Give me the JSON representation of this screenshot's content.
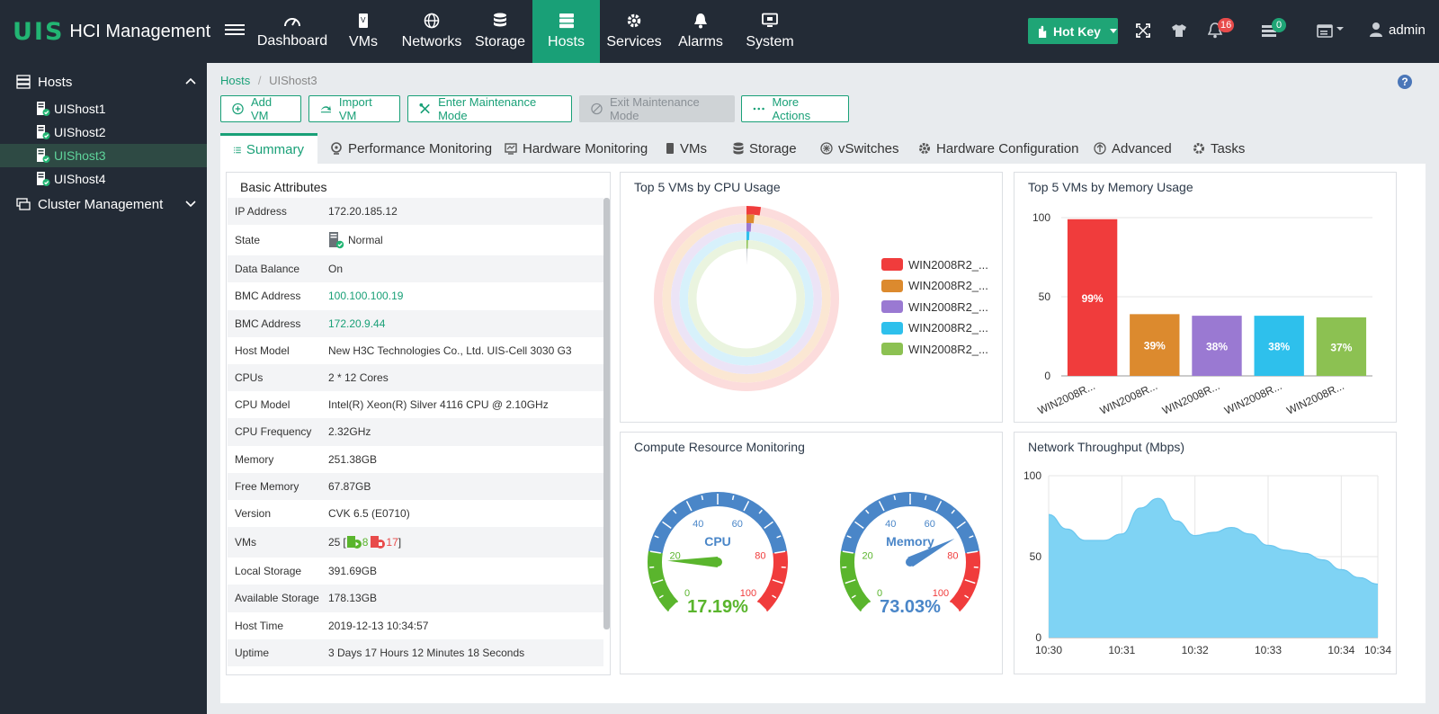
{
  "app": {
    "logo_mark": "UIS",
    "logo_text": "HCI Management"
  },
  "nav": [
    {
      "label": "Dashboard",
      "icon": "dashboard-icon"
    },
    {
      "label": "VMs",
      "icon": "vm-icon"
    },
    {
      "label": "Networks",
      "icon": "globe-icon"
    },
    {
      "label": "Storage",
      "icon": "database-icon"
    },
    {
      "label": "Hosts",
      "icon": "server-icon",
      "active": true
    },
    {
      "label": "Services",
      "icon": "gear-icon"
    },
    {
      "label": "Alarms",
      "icon": "bell-icon"
    },
    {
      "label": "System",
      "icon": "monitor-icon"
    }
  ],
  "topright": {
    "hotkey": "Hot Key",
    "alarm_count": "16",
    "task_count": "0",
    "user": "admin"
  },
  "sidebar": {
    "hosts_header": "Hosts",
    "hosts": [
      "UIShost1",
      "UIShost2",
      "UIShost3",
      "UIShost4"
    ],
    "active_host": "UIShost3",
    "cluster_header": "Cluster Management"
  },
  "breadcrumb": {
    "root": "Hosts",
    "sep": "/",
    "current": "UIShost3"
  },
  "actions": {
    "add_vm": "Add VM",
    "import_vm": "Import VM",
    "enter_maint": "Enter Maintenance Mode",
    "exit_maint": "Exit Maintenance Mode",
    "more": "More Actions"
  },
  "tabs": [
    "Summary",
    "Performance Monitoring",
    "Hardware Monitoring",
    "VMs",
    "Storage",
    "vSwitches",
    "Hardware Configuration",
    "Advanced",
    "Tasks"
  ],
  "basic": {
    "title": "Basic Attributes",
    "rows": [
      {
        "k": "IP Address",
        "v": "172.20.185.12"
      },
      {
        "k": "State",
        "v": "Normal"
      },
      {
        "k": "Data Balance",
        "v": "On"
      },
      {
        "k": "BMC Address",
        "v": "100.100.100.19"
      },
      {
        "k": "BMC Address",
        "v": "172.20.9.44"
      },
      {
        "k": "Host Model",
        "v": "New H3C Technologies Co., Ltd. UIS-Cell 3030 G3"
      },
      {
        "k": "CPUs",
        "v": "2 * 12 Cores"
      },
      {
        "k": "CPU Model",
        "v": "Intel(R) Xeon(R) Silver 4116 CPU @ 2.10GHz"
      },
      {
        "k": "CPU Frequency",
        "v": "2.32GHz"
      },
      {
        "k": "Memory",
        "v": "251.38GB"
      },
      {
        "k": "Free Memory",
        "v": "67.87GB"
      },
      {
        "k": "Version",
        "v": "CVK 6.5 (E0710)"
      },
      {
        "k": "VMs",
        "v": "25"
      },
      {
        "k": "Local Storage",
        "v": "391.69GB"
      },
      {
        "k": "Available Storage",
        "v": "178.13GB"
      },
      {
        "k": "Host Time",
        "v": "2019-12-13 10:34:57"
      },
      {
        "k": "Uptime",
        "v": "3 Days 17 Hours 12 Minutes 18 Seconds"
      }
    ],
    "vms_running": "8",
    "vms_stopped": "17"
  },
  "cpu_title": "Top 5 VMs by CPU Usage",
  "mem_title": "Top 5 VMs by Memory Usage",
  "gauge_title": "Compute Resource Monitoring",
  "net_title": "Network Throughput (Mbps)",
  "gauges": {
    "cpu": {
      "label": "CPU",
      "value": 17.19,
      "display": "17.19%",
      "color": "#5ab52d"
    },
    "mem": {
      "label": "Memory",
      "value": 73.03,
      "display": "73.03%",
      "color": "#4a86c8"
    },
    "ticks": [
      "0",
      "20",
      "40",
      "60",
      "80",
      "100"
    ]
  },
  "colors": {
    "accent": "#19a077",
    "red": "#f03c3c",
    "orange": "#dc8a2e",
    "purple": "#9a79d2",
    "blue": "#2ec0ec",
    "green": "#8cc152"
  },
  "chart_data": [
    {
      "type": "pie",
      "title": "Top 5 VMs by CPU Usage",
      "legend_position": "right",
      "series": [
        {
          "name": "WIN2008R2_...",
          "color": "#f03c3c",
          "value": 2.5
        },
        {
          "name": "WIN2008R2_...",
          "color": "#dc8a2e",
          "value": 1.5
        },
        {
          "name": "WIN2008R2_...",
          "color": "#9a79d2",
          "value": 1.0
        },
        {
          "name": "WIN2008R2_...",
          "color": "#2ec0ec",
          "value": 0.7
        },
        {
          "name": "WIN2008R2_...",
          "color": "#8cc152",
          "value": 0.4
        }
      ]
    },
    {
      "type": "bar",
      "title": "Top 5 VMs by Memory Usage",
      "categories": [
        "WIN2008R...",
        "WIN2008R...",
        "WIN2008R...",
        "WIN2008R...",
        "WIN2008R..."
      ],
      "values": [
        99,
        39,
        38,
        38,
        37
      ],
      "labels": [
        "99%",
        "39%",
        "38%",
        "38%",
        "37%"
      ],
      "colors": [
        "#f03c3c",
        "#dc8a2e",
        "#9a79d2",
        "#2ec0ec",
        "#8cc152"
      ],
      "ylim": [
        0,
        100
      ],
      "yticks": [
        "0",
        "50",
        "100"
      ],
      "grid": true
    },
    {
      "type": "area",
      "title": "Network Throughput (Mbps)",
      "x": [
        0,
        0.25,
        0.5,
        0.75,
        1.0,
        1.25,
        1.5,
        1.75,
        2.0,
        2.25,
        2.5,
        2.75,
        3.0,
        3.25,
        3.5,
        3.75,
        4.0,
        4.25,
        4.5
      ],
      "y": [
        76,
        67,
        60,
        60,
        64,
        80,
        86,
        72,
        63,
        65,
        68,
        64,
        57,
        54,
        52,
        48,
        42,
        37,
        33
      ],
      "xticks": [
        "10:30",
        "10:31",
        "10:32",
        "10:33",
        "10:34",
        "10:34"
      ],
      "xtick_pos": [
        0,
        1,
        2,
        3,
        4,
        4.5
      ],
      "ylim": [
        0,
        100
      ],
      "yticks": [
        "0",
        "50",
        "100"
      ],
      "color": "#7fd3f4",
      "grid": true
    }
  ]
}
